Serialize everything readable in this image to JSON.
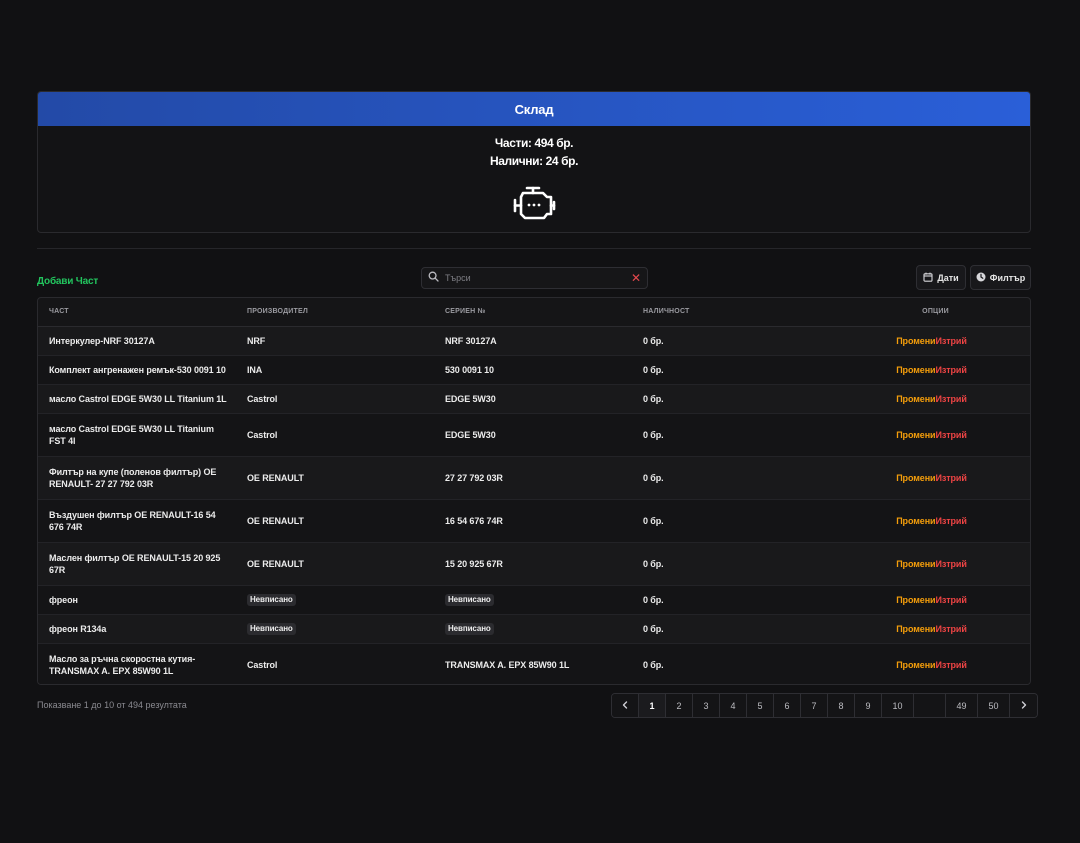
{
  "warehouse": {
    "title": "Склад",
    "parts_stat": "Части: 494 бр.",
    "available_stat": "Налични: 24 бр.",
    "icon": "engine-icon"
  },
  "toolbar": {
    "add_label": "Добави Част",
    "search_placeholder": "Търси",
    "dates_label": "Дати",
    "filter_label": "Филтър"
  },
  "table": {
    "headers": {
      "part": "Част",
      "manufacturer": "Производител",
      "serial": "Сериен №",
      "stock": "Наличност",
      "options": "Опции"
    },
    "rows": [
      {
        "part": "Интеркулер-NRF 30127A",
        "manufacturer": "NRF",
        "serial": "NRF 30127A",
        "stock": "0 бр.",
        "manufacturer_tag": false,
        "serial_tag": false
      },
      {
        "part": "Комплект ангренажен ремък-530 0091 10",
        "manufacturer": "INA",
        "serial": "530 0091 10",
        "stock": "0 бр.",
        "manufacturer_tag": false,
        "serial_tag": false
      },
      {
        "part": "масло Castrol EDGE 5W30 LL Titanium 1L",
        "manufacturer": "Castrol",
        "serial": "EDGE 5W30",
        "stock": "0 бр.",
        "manufacturer_tag": false,
        "serial_tag": false
      },
      {
        "part": "масло Castrol EDGE 5W30 LL Titanium FST 4l",
        "manufacturer": "Castrol",
        "serial": "EDGE 5W30",
        "stock": "0 бр.",
        "manufacturer_tag": false,
        "serial_tag": false
      },
      {
        "part": "Филтър на купе (поленов филтър) OE RENAULT- 27 27 792 03R",
        "manufacturer": "OE RENAULT",
        "serial": "27 27 792 03R",
        "stock": "0 бр.",
        "manufacturer_tag": false,
        "serial_tag": false
      },
      {
        "part": "Въздушен филтър OE RENAULT-16 54 676 74R",
        "manufacturer": "OE RENAULT",
        "serial": "16 54 676 74R",
        "stock": "0 бр.",
        "manufacturer_tag": false,
        "serial_tag": false
      },
      {
        "part": "Маслен филтър OE RENAULT-15 20 925 67R",
        "manufacturer": "OE RENAULT",
        "serial": "15 20 925 67R",
        "stock": "0 бр.",
        "manufacturer_tag": false,
        "serial_tag": false
      },
      {
        "part": "фреон",
        "manufacturer": "Невписано",
        "serial": "Невписано",
        "stock": "0 бр.",
        "manufacturer_tag": true,
        "serial_tag": true
      },
      {
        "part": "фреон R134a",
        "manufacturer": "Невписано",
        "serial": "Невписано",
        "stock": "0 бр.",
        "manufacturer_tag": true,
        "serial_tag": true
      },
      {
        "part": "Масло за ръчна скоростна кутия-TRANSMAX A. EPX 85W90 1L",
        "manufacturer": "Castrol",
        "serial": "TRANSMAX A. EPX 85W90 1L",
        "stock": "0 бр.",
        "manufacturer_tag": false,
        "serial_tag": false
      }
    ],
    "edit_label": "Промени",
    "delete_label": "Изтрий"
  },
  "pagination": {
    "summary": "Показване 1 до 10 от 494 резултата",
    "pages": [
      "1",
      "2",
      "3",
      "4",
      "5",
      "6",
      "7",
      "8",
      "9",
      "10",
      "",
      "49",
      "50"
    ],
    "current": "1"
  },
  "colors": {
    "header_blue": "#2a5fd8",
    "add_green": "#22c55e",
    "edit_orange": "#f59e0b",
    "delete_red": "#ef4444",
    "background": "#111113"
  }
}
